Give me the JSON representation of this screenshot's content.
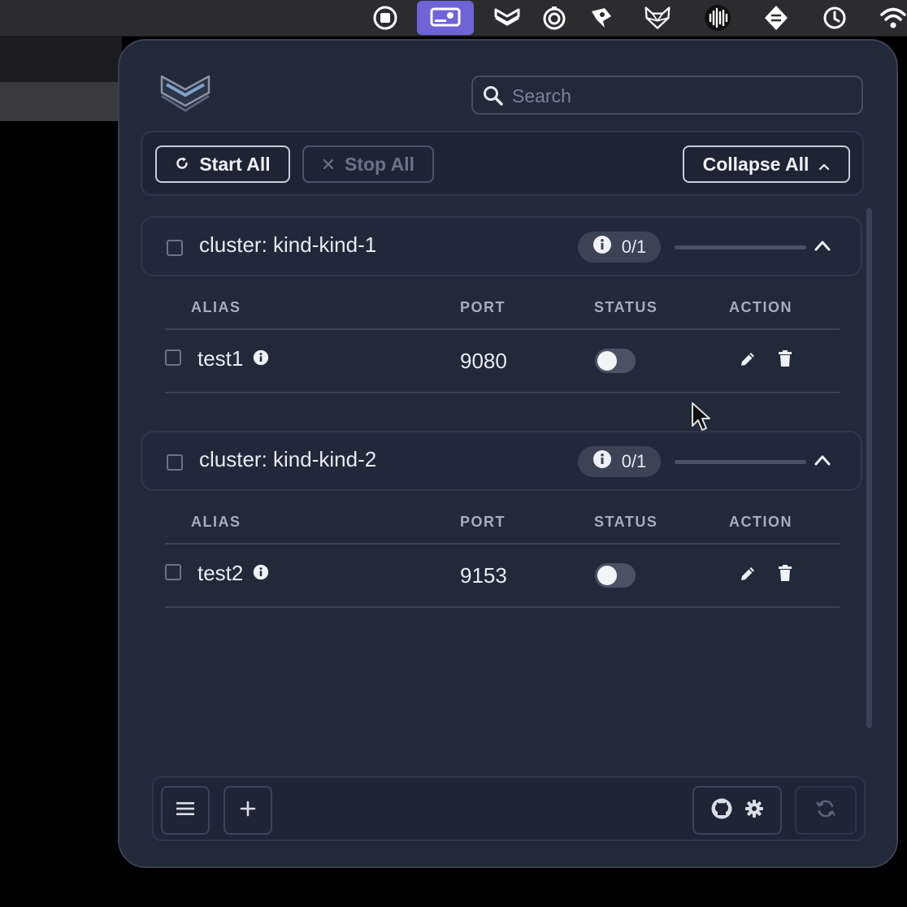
{
  "menubar": {
    "icons": [
      "record-icon",
      "ui-active-icon",
      "kftray-icon",
      "ring-icon",
      "pin-icon",
      "fox-icon",
      "audio-icon",
      "package-icon",
      "time-machine-icon",
      "wifi-icon"
    ]
  },
  "panel": {
    "search": {
      "placeholder": "Search",
      "value": ""
    },
    "toolbar": {
      "start_all": "Start All",
      "stop_all": "Stop All",
      "collapse_all": "Collapse All"
    },
    "table_headers": {
      "alias": "ALIAS",
      "port": "PORT",
      "status": "STATUS",
      "action": "ACTION"
    },
    "clusters": [
      {
        "name": "cluster: kind-kind-1",
        "count": "0/1",
        "progress": 0,
        "rows": [
          {
            "alias": "test1",
            "port": "9080",
            "status_on": false
          }
        ]
      },
      {
        "name": "cluster: kind-kind-2",
        "count": "0/1",
        "progress": 0,
        "rows": [
          {
            "alias": "test2",
            "port": "9153",
            "status_on": false
          }
        ]
      }
    ]
  },
  "colors": {
    "panel_bg": "#222939",
    "accent": "#6f63d8",
    "border": "#30374a",
    "text": "#e8ebf1",
    "muted": "#a6adbb"
  }
}
